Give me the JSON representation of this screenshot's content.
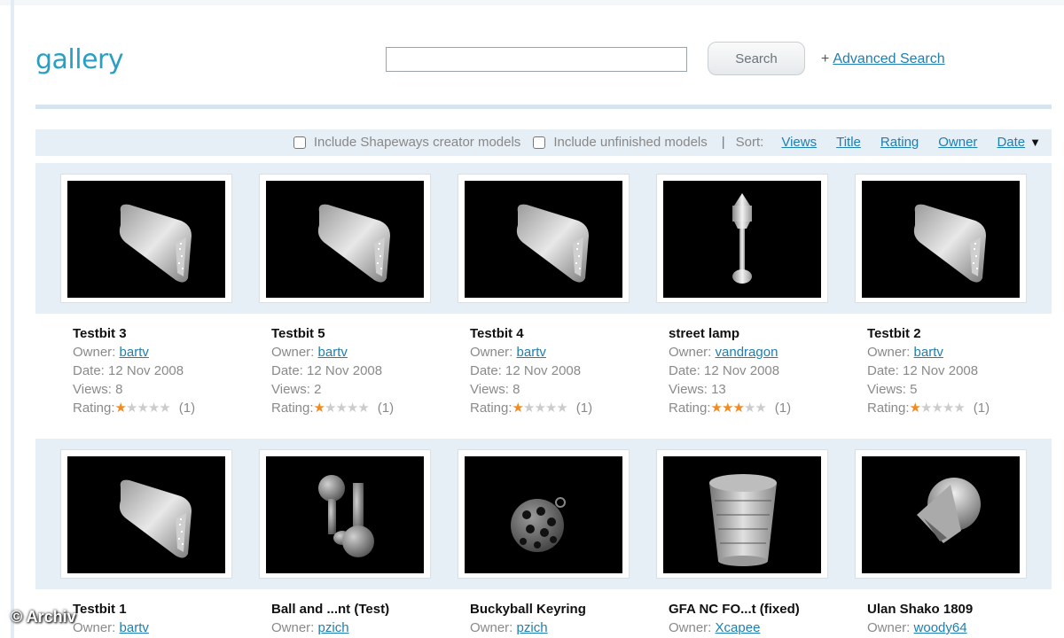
{
  "header": {
    "logo": "gallery",
    "search_placeholder": "",
    "search_button": "Search",
    "advanced_prefix": "+",
    "advanced_link": "Advanced Search"
  },
  "filters": {
    "include_creator": "Include Shapeways creator models",
    "include_unfinished": "Include unfinished models",
    "separator": "|",
    "sort_label": "Sort:",
    "sort_options": [
      "Views",
      "Title",
      "Rating",
      "Owner",
      "Date"
    ],
    "sort_arrow": "▼"
  },
  "labels": {
    "owner": "Owner:",
    "date": "Date:",
    "views": "Views:",
    "rating": "Rating:"
  },
  "colors": {
    "brand": "#2a9fc4",
    "link": "#1e7fb0",
    "star_on": "#f08a24",
    "band": "#e6eef6"
  },
  "items": [
    {
      "title": "Testbit 3",
      "owner": "bartv",
      "date": "12 Nov 2008",
      "views": "8",
      "rating": 1,
      "count": "(1)",
      "thumb": "plate-icon"
    },
    {
      "title": "Testbit 5",
      "owner": "bartv",
      "date": "12 Nov 2008",
      "views": "2",
      "rating": 1,
      "count": "(1)",
      "thumb": "plate-icon"
    },
    {
      "title": "Testbit 4",
      "owner": "bartv",
      "date": "12 Nov 2008",
      "views": "8",
      "rating": 1,
      "count": "(1)",
      "thumb": "plate-icon"
    },
    {
      "title": "street lamp",
      "owner": "vandragon",
      "date": "12 Nov 2008",
      "views": "13",
      "rating": 3,
      "count": "(1)",
      "thumb": "lamp-icon"
    },
    {
      "title": "Testbit 2",
      "owner": "bartv",
      "date": "12 Nov 2008",
      "views": "5",
      "rating": 1,
      "count": "(1)",
      "thumb": "plate-icon"
    },
    {
      "title": "Testbit 1",
      "owner": "bartv",
      "thumb": "plate-icon"
    },
    {
      "title": "Ball and ...nt (Test)",
      "owner": "pzich",
      "thumb": "ball-icon"
    },
    {
      "title": "Buckyball Keyring",
      "owner": "pzich",
      "thumb": "buckyball-icon"
    },
    {
      "title": "GFA NC FO...t (fixed)",
      "owner": "Xcapee",
      "thumb": "cylinder-icon"
    },
    {
      "title": "Ulan Shako 1809",
      "owner": "woody64",
      "thumb": "shako-icon"
    }
  ],
  "watermark": "© Archiv"
}
